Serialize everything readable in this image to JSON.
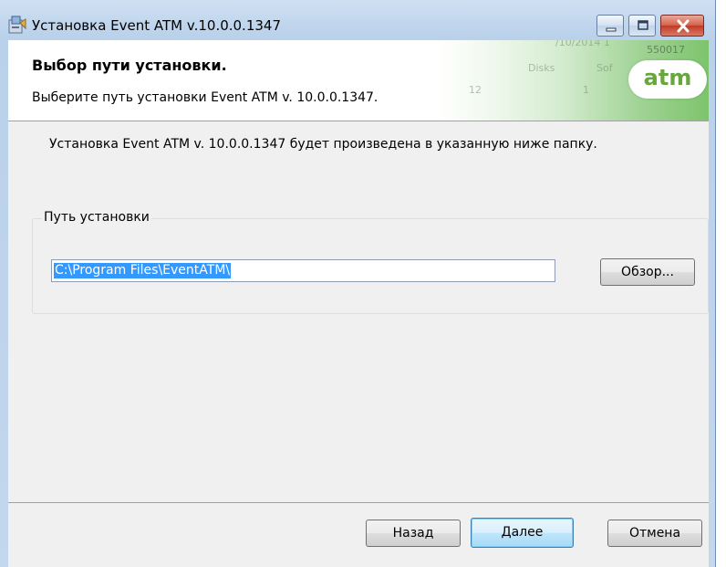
{
  "window": {
    "title": "Установка Event ATM v.10.0.0.1347"
  },
  "banner": {
    "heading": "Выбор пути установки.",
    "subtitle": "Выберите путь установки Event ATM v. 10.0.0.1347.",
    "logo_text": "atm",
    "background_fragments": [
      "/10/2014 1",
      "550017",
      "Disks",
      "Sof",
      "12",
      "1"
    ]
  },
  "main": {
    "intro": "Установка Event ATM v. 10.0.0.1347 будет произведена в указанную ниже папку.",
    "group": {
      "legend": "Путь установки",
      "path_value": "C:\\Program Files\\EventATM\\",
      "browse_label": "Обзор..."
    }
  },
  "footer": {
    "back_label": "Назад",
    "next_label": "Далее",
    "cancel_label": "Отмена"
  },
  "colors": {
    "accent": "#3399ff",
    "logo_green": "#68a63f",
    "close_button": "#c13b24"
  }
}
